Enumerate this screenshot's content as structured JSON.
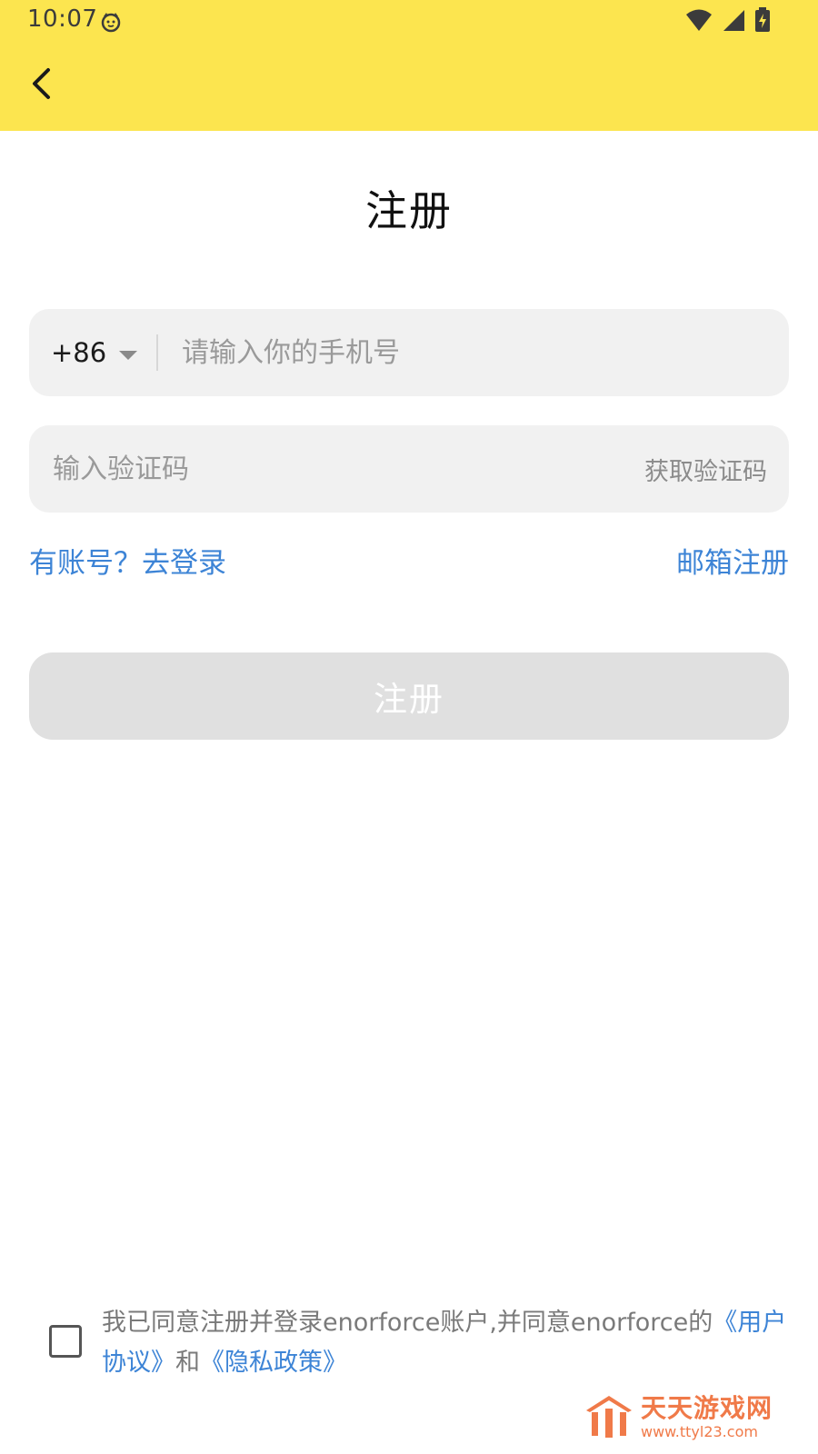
{
  "status_bar": {
    "time": "10:07"
  },
  "page": {
    "title": "注册"
  },
  "phone_field": {
    "country_code": "+86",
    "placeholder": "请输入你的手机号"
  },
  "code_field": {
    "placeholder": "输入验证码",
    "get_code_label": "获取验证码"
  },
  "links": {
    "login": "有账号？去登录",
    "email_register": "邮箱注册"
  },
  "submit_label": "注册",
  "agreement": {
    "prefix": "我已同意注册并登录enorforce账户,并同意enorforce的",
    "user_agreement": "《用户协议》",
    "conjunction": "和",
    "privacy_policy": "《隐私政策》"
  },
  "watermark": {
    "title": "天天游戏网",
    "url": "www.ttyl23.com"
  },
  "colors": {
    "header_bg": "#fce54f",
    "link_blue": "#3d84d6",
    "field_bg": "#f1f1f1",
    "button_disabled": "#e0e0e0",
    "watermark_orange": "#f07a49"
  },
  "icons": [
    "cat-face-icon",
    "wifi-icon",
    "signal-icon",
    "battery-charging-icon",
    "back-arrow-icon",
    "dropdown-caret-icon",
    "watermark-logo-icon"
  ]
}
